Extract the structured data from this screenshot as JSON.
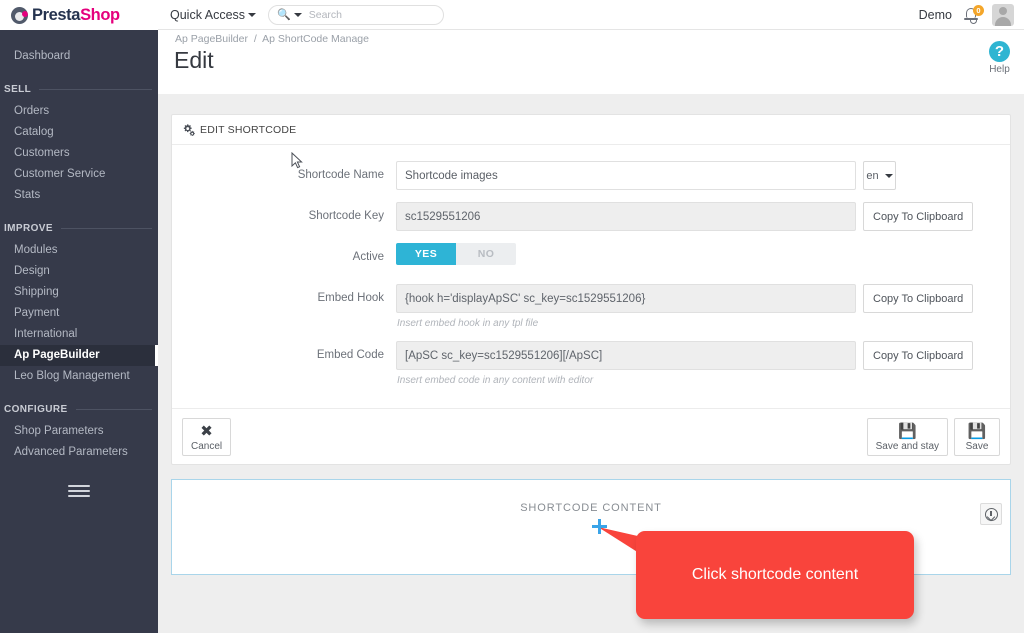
{
  "brand": {
    "part1": "Presta",
    "part2": "Shop"
  },
  "header": {
    "quick_access": "Quick Access",
    "search_placeholder": "Search",
    "search_icon": "magnifier-icon",
    "demo": "Demo",
    "notification_count": "0"
  },
  "sidebar": {
    "items": [
      {
        "label": "Dashboard",
        "type": "item",
        "active": false
      },
      {
        "label": "SELL",
        "type": "section"
      },
      {
        "label": "Orders",
        "type": "item",
        "active": false
      },
      {
        "label": "Catalog",
        "type": "item",
        "active": false
      },
      {
        "label": "Customers",
        "type": "item",
        "active": false
      },
      {
        "label": "Customer Service",
        "type": "item",
        "active": false
      },
      {
        "label": "Stats",
        "type": "item",
        "active": false
      },
      {
        "label": "IMPROVE",
        "type": "section"
      },
      {
        "label": "Modules",
        "type": "item",
        "active": false
      },
      {
        "label": "Design",
        "type": "item",
        "active": false
      },
      {
        "label": "Shipping",
        "type": "item",
        "active": false
      },
      {
        "label": "Payment",
        "type": "item",
        "active": false
      },
      {
        "label": "International",
        "type": "item",
        "active": false
      },
      {
        "label": "Ap PageBuilder",
        "type": "item",
        "active": true
      },
      {
        "label": "Leo Blog Management",
        "type": "item",
        "active": false
      },
      {
        "label": "CONFIGURE",
        "type": "section"
      },
      {
        "label": "Shop Parameters",
        "type": "item",
        "active": false
      },
      {
        "label": "Advanced Parameters",
        "type": "item",
        "active": false
      }
    ],
    "collapse_icon": "hamburger-icon"
  },
  "page": {
    "breadcrumb": {
      "parent": "Ap PageBuilder",
      "separator": "/",
      "current": "Ap ShortCode Manage"
    },
    "title": "Edit",
    "help_label": "Help",
    "help_icon": "question-mark-icon"
  },
  "panel": {
    "heading": "EDIT SHORTCODE",
    "heading_icon": "cogs-icon",
    "fields": {
      "shortcode_name": {
        "label": "Shortcode Name",
        "value": "Shortcode images",
        "lang": "en"
      },
      "shortcode_key": {
        "label": "Shortcode Key",
        "value": "sc1529551206",
        "copy_label": "Copy To Clipboard"
      },
      "active": {
        "label": "Active",
        "yes": "YES",
        "no": "NO",
        "selected": "YES"
      },
      "embed_hook": {
        "label": "Embed Hook",
        "value": "{hook h='displayApSC' sc_key=sc1529551206}",
        "hint": "Insert embed hook in any tpl file",
        "copy_label": "Copy To Clipboard"
      },
      "embed_code": {
        "label": "Embed Code",
        "value": "[ApSC sc_key=sc1529551206][/ApSC]",
        "hint": "Insert embed code in any content with editor",
        "copy_label": "Copy To Clipboard"
      }
    },
    "footer": {
      "cancel": "Cancel",
      "cancel_icon": "close-x-icon",
      "save_and_stay": "Save and stay",
      "save_and_stay_icon": "floppy-disk-icon",
      "save": "Save",
      "save_icon": "floppy-disk-icon"
    }
  },
  "shortcode_content": {
    "title": "SHORTCODE CONTENT",
    "tool_icon": "circle-down-arrow-icon"
  },
  "annotation": {
    "callout_text": "Click shortcode content",
    "callout_color": "#f9443c",
    "cursor_icon": "plus-cursor-icon"
  },
  "colors": {
    "sidebar_bg": "#363a4a",
    "accent_blue": "#2eb4d6",
    "brand_pink": "#e5007d",
    "brand_navy": "#25334f",
    "badge_orange": "#f4a62a",
    "callout_red": "#f9443c"
  }
}
